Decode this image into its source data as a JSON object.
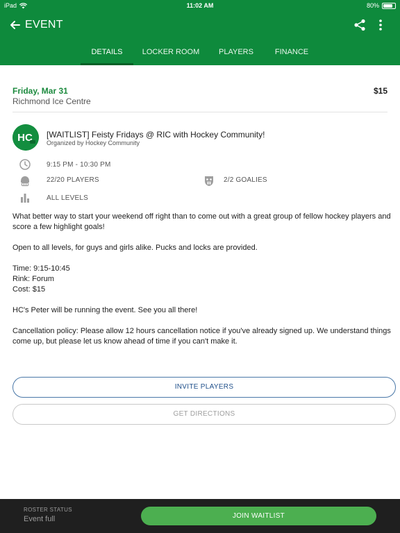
{
  "status_bar": {
    "device": "iPad",
    "time": "11:02 AM",
    "battery": "80%",
    "battery_level": 0.8
  },
  "app_bar": {
    "title": "EVENT"
  },
  "tabs": [
    {
      "label": "DETAILS",
      "active": true
    },
    {
      "label": "LOCKER ROOM",
      "active": false
    },
    {
      "label": "PLAYERS",
      "active": false
    },
    {
      "label": "FINANCE",
      "active": false
    }
  ],
  "event": {
    "date": "Friday, Mar 31",
    "venue": "Richmond Ice Centre",
    "price": "$15",
    "logo_text": "HC",
    "title": "[WAITLIST] Feisty Fridays @ RIC with Hockey Community!",
    "organizer": "Organized by Hockey Community",
    "time": "9:15 PM - 10:30 PM",
    "players": "22/20 PLAYERS",
    "goalies": "2/2 GOALIES",
    "levels": "ALL LEVELS",
    "description": [
      "What better way to start your weekend off right than to come out with a great group of fellow hockey players and score a few highlight goals!",
      "",
      "Open to all levels, for guys and girls alike.  Pucks and locks are provided.",
      "",
      "Time: 9:15-10:45",
      "Rink: Forum",
      "Cost: $15",
      "",
      "HC's Peter will be running the event.  See you all there!",
      "",
      "Cancellation policy: Please allow 12 hours cancellation notice if you've already signed up.  We understand things come up, but please let us know ahead of time if you can't make it."
    ]
  },
  "buttons": {
    "invite": "INVITE PLAYERS",
    "directions": "GET DIRECTIONS",
    "join": "JOIN WAITLIST"
  },
  "roster": {
    "label": "ROSTER STATUS",
    "value": "Event full"
  },
  "colors": {
    "primary": "#0e8a3c",
    "accent_green": "#4caf50",
    "date_green": "#1c8a3e",
    "invite_blue": "#1f4f8a",
    "bottom_bar": "#1f1f1f"
  },
  "icons": {
    "back": "arrow-left-icon",
    "share": "share-icon",
    "more": "more-vert-icon",
    "time": "clock-icon",
    "players": "helmet-icon",
    "goalies": "goalie-mask-icon",
    "levels": "bar-chart-icon",
    "wifi": "wifi-icon",
    "battery": "battery-icon"
  }
}
